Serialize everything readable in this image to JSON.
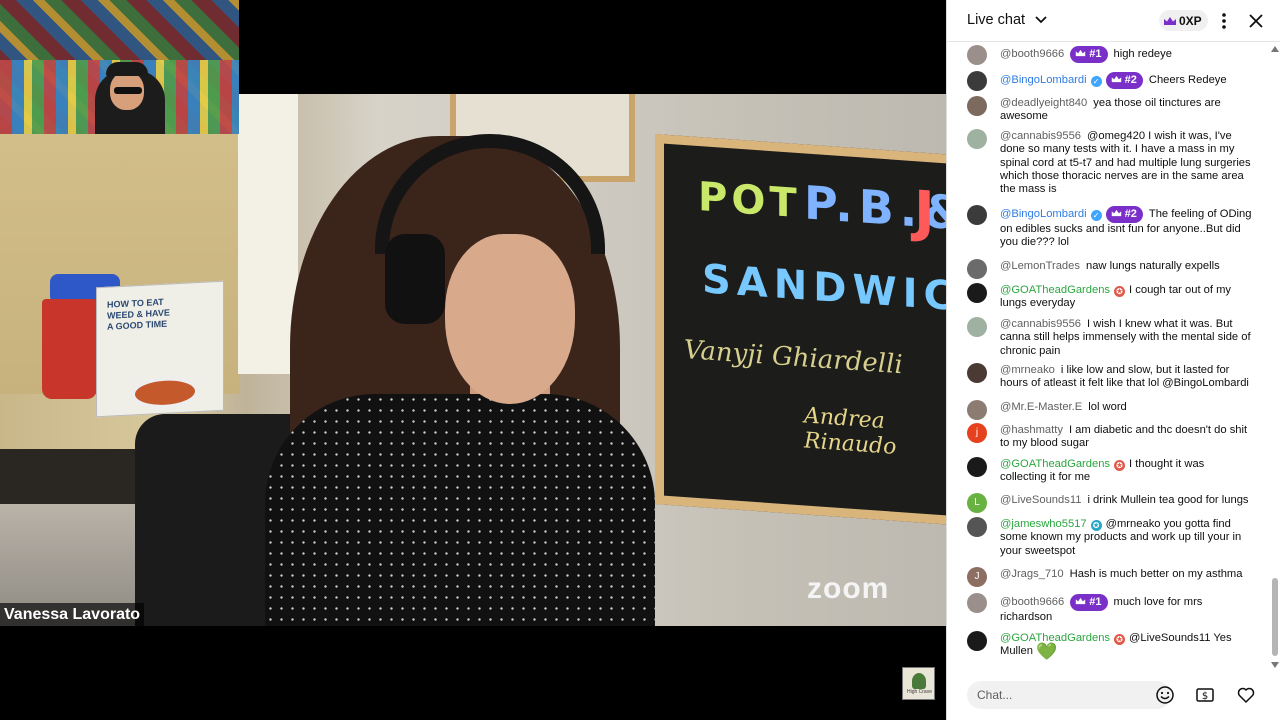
{
  "stream": {
    "speaker_name": "Vanessa Lavorato",
    "watermark": "zoom",
    "book_title": "HOW TO EAT WEED & HAVE A GOOD TIME",
    "chalkboard": {
      "line1a": "POT",
      "line1b": "P.B.&",
      "line1c": "J",
      "line2": "SANDWICH",
      "sig1": "Vanyji  Ghiardelli",
      "sig2": "Andrea Rinaudo"
    },
    "channel_badge_text": "High Crave"
  },
  "chat": {
    "title": "Live chat",
    "xp": "0XP",
    "input_placeholder": "Chat...",
    "colors": {
      "mod_blue": "#2f7de1",
      "member_green": "#2ba640",
      "rank_purple": "#7b2fc9"
    },
    "messages": [
      {
        "author": "@booth9666",
        "rank": "#1",
        "text": "high redeye",
        "avatar_color": "#9a8f8a"
      },
      {
        "author": "@BingoLombardi",
        "rank": "#2",
        "text": "Cheers Redeye",
        "avatar_color": "#3b3b3b"
      },
      {
        "author": "@deadlyeight840",
        "text": "yea those oil tinctures are awesome",
        "avatar_color": "#7c6a5e"
      },
      {
        "author": "@cannabis9556",
        "text": "@omeg420 I wish it was, I've done so many tests with it. I have a mass in my spinal cord at t5-t7 and had multiple lung surgeries which those thoracic nerves are in the same area the mass is",
        "avatar_color": "#9fb2a2"
      },
      {
        "author": "@BingoLombardi",
        "rank": "#2",
        "text": "The feeling of ODing on edibles sucks and isnt fun for anyone..But did you die??? lol",
        "avatar_color": "#3b3b3b"
      },
      {
        "author": "@LemonTrades",
        "text": "naw lungs naturally expells",
        "avatar_color": "#6b6b6b"
      },
      {
        "author": "@GOATheadGardens",
        "text": "I cough tar out of my lungs everyday",
        "avatar_color": "#1a1a1a"
      },
      {
        "author": "@cannabis9556",
        "text": "I wish I knew what it was. But canna still helps immensely with the mental side of chronic pain",
        "avatar_color": "#9fb2a2"
      },
      {
        "author": "@mrneako",
        "text": "i like low and slow, but it lasted for hours of atleast it felt like that lol @BingoLombardi",
        "avatar_color": "#4a3a33"
      },
      {
        "author": "@Mr.E-Master.E",
        "text": "lol word",
        "avatar_color": "#8c7b70"
      },
      {
        "author": "@hashmatty",
        "text": "I am diabetic and thc doesn't do shit to my blood sugar",
        "avatar_letter": "j",
        "avatar_color": "#e5411f"
      },
      {
        "author": "@GOATheadGardens",
        "text": "I thought it was collecting it for me",
        "avatar_color": "#1a1a1a"
      },
      {
        "author": "@LiveSounds11",
        "text": "i drink Mullein tea good for lungs",
        "avatar_letter": "L",
        "avatar_color": "#67b240"
      },
      {
        "author": "@jameswho5517",
        "text": "@mrneako you gotta find some known my products and work up till your in your sweetspot",
        "avatar_color": "#555"
      },
      {
        "author": "@Jrags_710",
        "text": "Hash is much better on my asthma",
        "avatar_letter": "J",
        "avatar_color": "#8d6e63"
      },
      {
        "author": "@booth9666",
        "rank": "#1",
        "text": "much love for mrs richardson",
        "avatar_color": "#9a8f8a"
      },
      {
        "author": "@GOATheadGardens",
        "text": "@LiveSounds11 Yes Mullen",
        "emoji": "💚",
        "avatar_color": "#1a1a1a"
      }
    ]
  }
}
